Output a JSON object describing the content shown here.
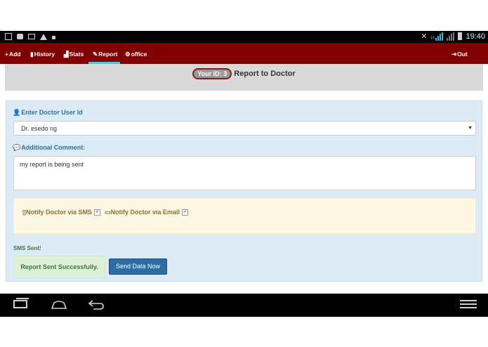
{
  "status_bar": {
    "left_icons": [
      "image-icon",
      "chat-icon",
      "mail-icon",
      "warning-icon",
      "lock-icon"
    ],
    "right_icons": [
      "mute-icon",
      "hspa-signal-icon",
      "signal-icon",
      "battery-icon"
    ],
    "hspa": "H",
    "time": "19:40"
  },
  "navbar": {
    "items": [
      {
        "icon": "+",
        "label": "Add"
      },
      {
        "icon": "▮",
        "label": "History"
      },
      {
        "icon": "▟",
        "label": "Stats"
      },
      {
        "icon": "✎",
        "label": "Report"
      },
      {
        "icon": "⚙",
        "label": "office"
      }
    ],
    "active_index": 3,
    "logout": {
      "icon": "⇥",
      "label": "Out"
    }
  },
  "header": {
    "badge": "Your ID: 3",
    "title": "Report to Doctor"
  },
  "form": {
    "doctor_label": "Enter Doctor User Id",
    "doctor_selected": "Dr. esedo ng",
    "comment_label": "Additional Comment:",
    "comment_value": "my report is being sent",
    "notify_sms_label": "Notify Doctor via SMS",
    "notify_sms_checked": true,
    "notify_email_label": "Notify Doctor via Email",
    "notify_email_checked": true,
    "sms_status": "SMS Sent!",
    "success_message": "Report Sent Successfully.",
    "send_button": "Send Data Now"
  },
  "colors": {
    "navbar": "#800000",
    "active_tab_indicator": "#5bc0de",
    "panel": "#dcebf5",
    "primary_button": "#2e6da4",
    "success": "#3c763d"
  }
}
